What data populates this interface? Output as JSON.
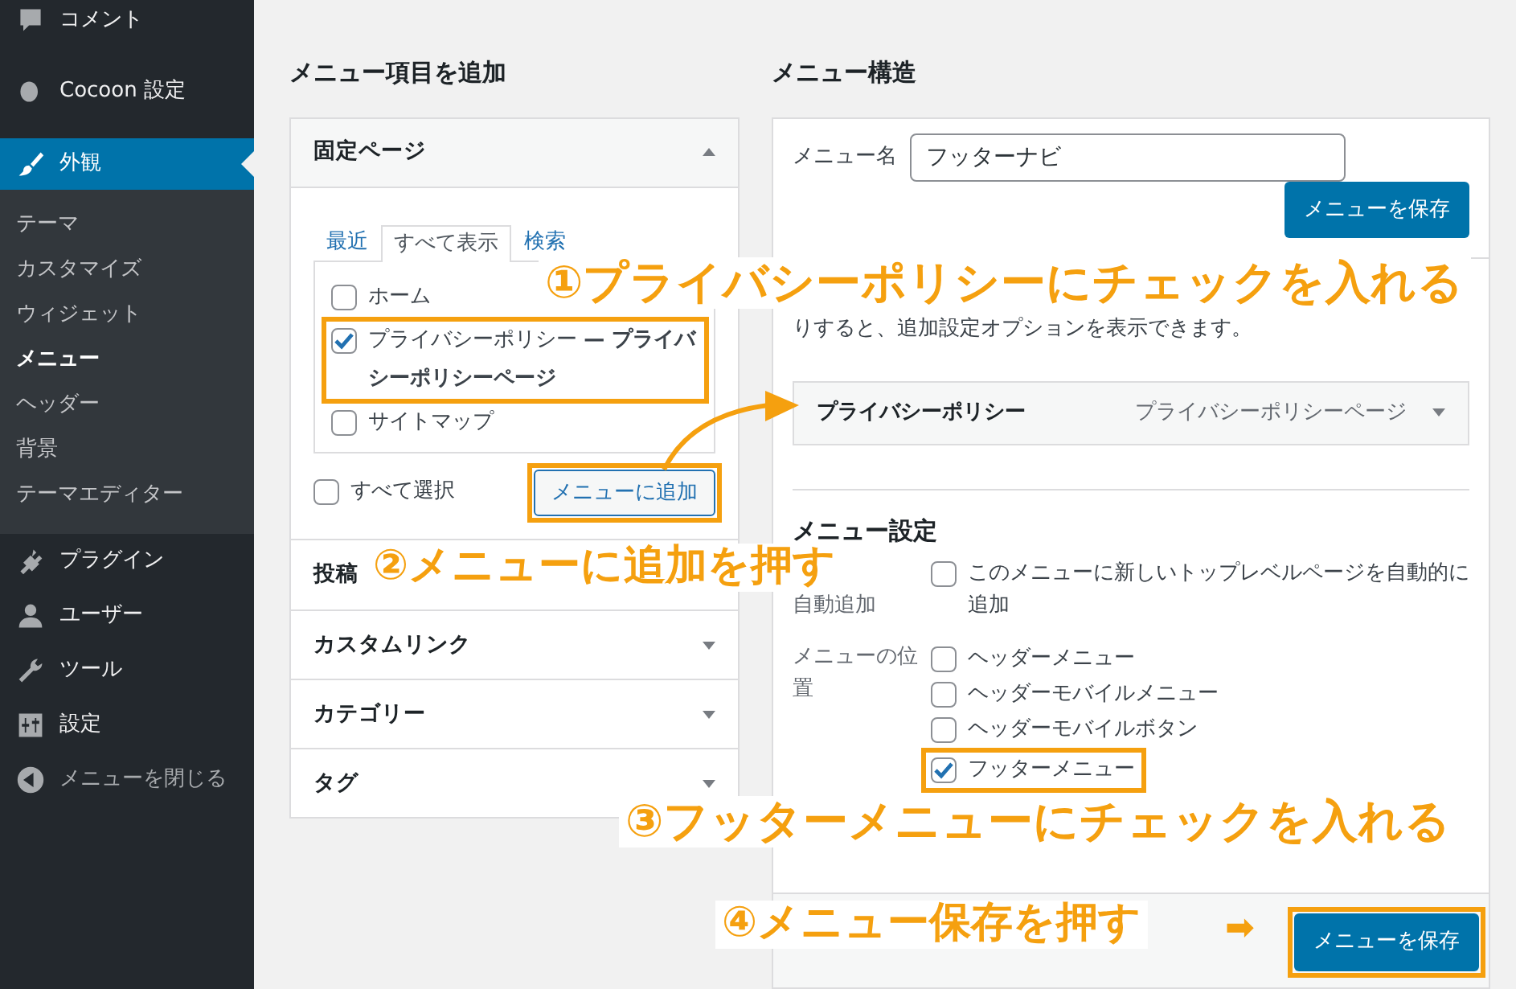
{
  "sidebar": {
    "items": [
      {
        "label": "コメント",
        "selected": false
      },
      {
        "label": "Cocoon 設定",
        "selected": false
      },
      {
        "label": "外観",
        "selected": true,
        "submenu": [
          {
            "label": "テーマ",
            "selected": false
          },
          {
            "label": "カスタマイズ",
            "selected": false
          },
          {
            "label": "ウィジェット",
            "selected": false
          },
          {
            "label": "メニュー",
            "selected": true
          },
          {
            "label": "ヘッダー",
            "selected": false
          },
          {
            "label": "背景",
            "selected": false
          },
          {
            "label": "テーマエディター",
            "selected": false
          }
        ]
      },
      {
        "label": "プラグイン",
        "selected": false
      },
      {
        "label": "ユーザー",
        "selected": false
      },
      {
        "label": "ツール",
        "selected": false
      },
      {
        "label": "設定",
        "selected": false
      }
    ],
    "collapse": "メニューを閉じる"
  },
  "left_panel": {
    "title": "メニュー項目を追加",
    "sections": [
      {
        "title": "固定ページ",
        "expanded": true,
        "tabs": [
          {
            "label": "最近",
            "selected": false
          },
          {
            "label": "すべて表示",
            "selected": true
          },
          {
            "label": "検索",
            "selected": false
          }
        ],
        "items": [
          {
            "label": "ホーム",
            "checked": false
          },
          {
            "label": "プライバシーポリシー **— プライバシーポリシーページ**",
            "checked": true
          },
          {
            "label": "サイトマップ",
            "checked": false
          }
        ],
        "select_all": {
          "label": "すべて選択",
          "checked": false
        },
        "add_button": "メニューに追加"
      },
      {
        "title": "投稿",
        "expanded": false
      },
      {
        "title": "カスタムリンク",
        "expanded": false
      },
      {
        "title": "カテゴリー",
        "expanded": false
      },
      {
        "title": "タグ",
        "expanded": false
      }
    ]
  },
  "right_panel": {
    "title": "メニュー構造",
    "menu_name": {
      "label": "メニュー名",
      "value": "フッターナビ"
    },
    "save_button": "メニューを保存",
    "hint": "りすると、追加設定オプションを表示できます。",
    "menu_items": [
      {
        "title": "プライバシーポリシー",
        "type": "プライバシーポリシーページ",
        "expanded": false
      }
    ],
    "settings": {
      "title": "メニュー設定",
      "auto_add": {
        "label": "自動追加",
        "option": "このメニューに新しいトップレベルページを自動的に追加",
        "checked": false
      },
      "locations": {
        "label": "メニューの位置",
        "options": [
          {
            "label": "ヘッダーメニュー",
            "checked": false
          },
          {
            "label": "ヘッダーモバイルメニュー",
            "checked": false
          },
          {
            "label": "ヘッダーモバイルボタン",
            "checked": false
          },
          {
            "label": "フッターメニュー",
            "checked": true
          }
        ]
      }
    },
    "footer_save_button": "メニューを保存"
  },
  "annotations": {
    "steps": [
      "①プライバシーポリシーにチェックを入れる",
      "②メニューに追加を押す",
      "③フッターメニューにチェックを入れる",
      "④メニュー保存を押す"
    ],
    "arrow": "➡"
  }
}
